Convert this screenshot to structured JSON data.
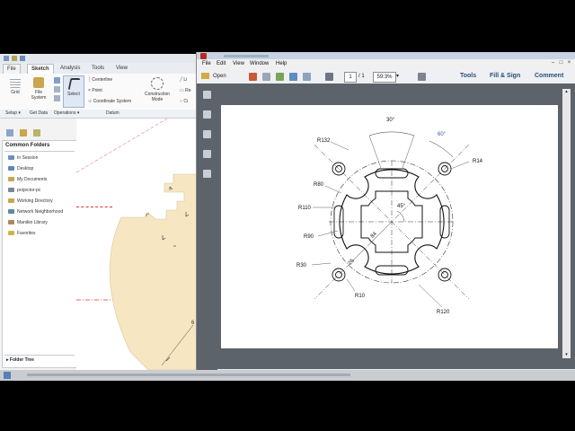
{
  "cad": {
    "file_menu": "File",
    "tabs": [
      "Sketch",
      "Analysis",
      "Tools",
      "View"
    ],
    "ribbon": {
      "grid": "Grid",
      "file_system": "File System",
      "select": "Select",
      "centerline": "Centerline",
      "point": "Point",
      "coordinate_system": "Coordinate System",
      "construction_mode": "Construction Mode",
      "line_partial": "Li",
      "rect_partial": "Re",
      "circle_partial": "Ci"
    },
    "groups": {
      "setup": "Setup",
      "get_data": "Get Data",
      "operations": "Operations",
      "datum": "Datum"
    },
    "browser": {
      "header": "Common Folders",
      "folders": [
        "In Session",
        "Desktop",
        "My Documents",
        "projector-pc",
        "Working Directory",
        "Network Neighborhood",
        "Manikin Library",
        "Favorites"
      ],
      "folder_tree": "Folder Tree"
    },
    "canvas_dimension": "6"
  },
  "pdf": {
    "menu": [
      "File",
      "Edit",
      "View",
      "Window",
      "Help"
    ],
    "toolbar": {
      "open": "Open",
      "page_current": "1",
      "page_total": "/ 1",
      "zoom": "59.3%",
      "tools": "Tools",
      "fill_sign": "Fill & Sign",
      "comment": "Comment"
    },
    "drawing": {
      "angle_top": "30°",
      "angle_corner": "60°",
      "r132": "R132",
      "r14": "R14",
      "r80": "R80",
      "r110": "R110",
      "r90": "R90",
      "r30": "R30",
      "r10": "R10",
      "r120": "R120",
      "angle_45": "45°",
      "dim_84": "84",
      "dim_25": "25"
    }
  },
  "colors": {
    "sketch_fill": "#f6e6c2",
    "cad_accent": "#2e6db4",
    "pdf_link": "#2b4d7c"
  }
}
